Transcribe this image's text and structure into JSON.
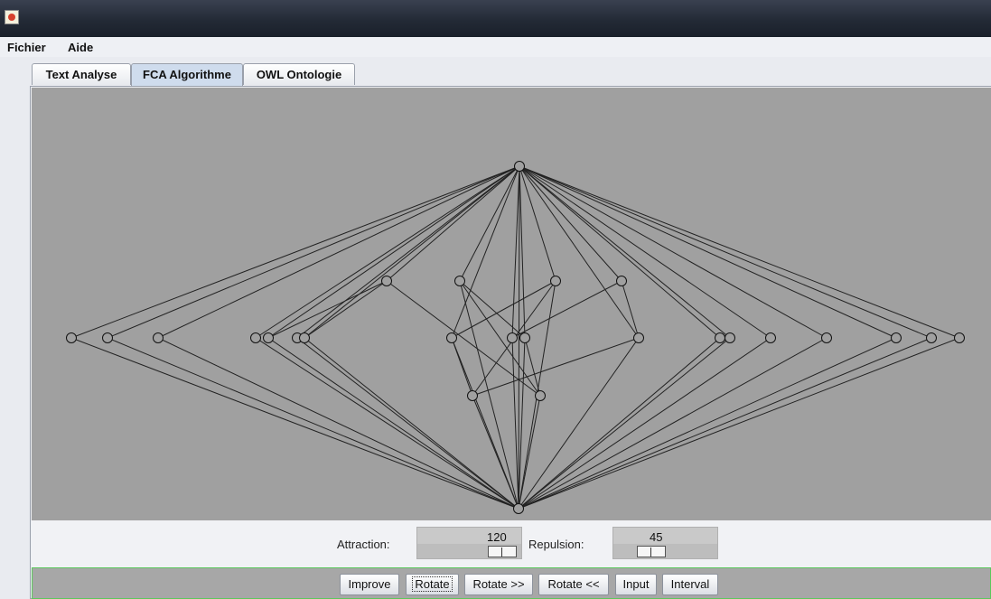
{
  "window": {
    "icon": "java-cup-icon"
  },
  "menu": {
    "items": [
      "Fichier",
      "Aide"
    ]
  },
  "tabs": [
    "Text Analyse",
    "FCA Algorithme",
    "OWL Ontologie"
  ],
  "active_tab": "FCA Algorithme",
  "controls": {
    "attraction_label": "Attraction:",
    "attraction_value": "120",
    "repulsion_label": "Repulsion:",
    "repulsion_value": "45"
  },
  "buttons": [
    "Improve",
    "Rotate",
    "Rotate >>",
    "Rotate <<",
    "Input",
    "Interval"
  ],
  "focused_button": "Rotate",
  "colors": {
    "canvas": "#a0a0a0",
    "edge": "#222222",
    "node_stroke": "#111111",
    "button_bar_border": "#5cc85c"
  }
}
